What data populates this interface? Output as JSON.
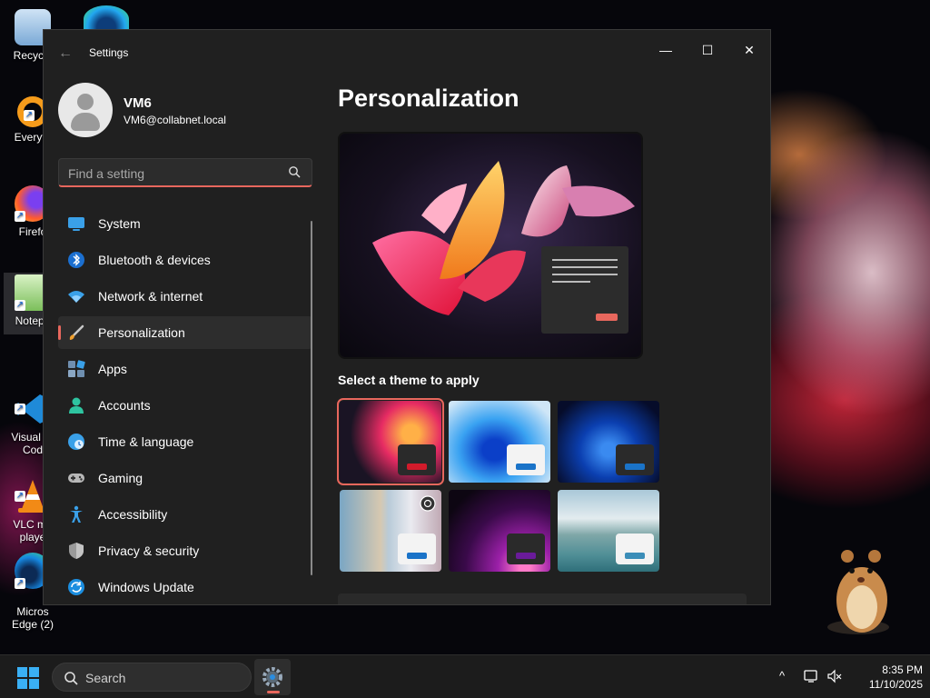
{
  "desktop": {
    "icons": [
      {
        "label": "Recycle"
      },
      {
        "label": "Everyth"
      },
      {
        "label": "Firefo"
      },
      {
        "label": "Notepa"
      },
      {
        "label": "Visual St\nCod"
      },
      {
        "label": "VLC me\nplaye"
      },
      {
        "label": "Micros\nEdge (2)"
      }
    ]
  },
  "window": {
    "app_title": "Settings",
    "controls": {
      "minimize": "—",
      "maximize": "☐",
      "close": "✕"
    }
  },
  "profile": {
    "name": "VM6",
    "email": "VM6@collabnet.local"
  },
  "search": {
    "placeholder": "Find a setting"
  },
  "nav": {
    "items": [
      {
        "label": "System",
        "icon": "monitor-icon"
      },
      {
        "label": "Bluetooth & devices",
        "icon": "bluetooth-icon"
      },
      {
        "label": "Network & internet",
        "icon": "wifi-icon"
      },
      {
        "label": "Personalization",
        "icon": "paintbrush-icon",
        "active": true
      },
      {
        "label": "Apps",
        "icon": "apps-icon"
      },
      {
        "label": "Accounts",
        "icon": "person-icon"
      },
      {
        "label": "Time & language",
        "icon": "globe-clock-icon"
      },
      {
        "label": "Gaming",
        "icon": "gamepad-icon"
      },
      {
        "label": "Accessibility",
        "icon": "accessibility-icon"
      },
      {
        "label": "Privacy & security",
        "icon": "shield-icon"
      },
      {
        "label": "Windows Update",
        "icon": "update-icon"
      }
    ]
  },
  "content": {
    "page_title": "Personalization",
    "theme_section_label": "Select a theme to apply",
    "themes": [
      {
        "name": "glow-dark",
        "selected": true,
        "chip_bar_color": "#d21b2b"
      },
      {
        "name": "bloom-light",
        "chip_bar_color": "#1a73c8"
      },
      {
        "name": "bloom-dark",
        "chip_bar_color": "#1a73c8"
      },
      {
        "name": "spotlight",
        "chip_bar_color": "#1a73c8"
      },
      {
        "name": "captured-motion",
        "chip_bar_color": "#6a1b9a"
      },
      {
        "name": "flow",
        "chip_bar_color": "#3b8db8"
      }
    ]
  },
  "taskbar": {
    "search_label": "Search",
    "time": "8:35 PM",
    "date": "11/10/2025",
    "tray_chevron": "^"
  },
  "colors": {
    "accent": "#e8675d",
    "window_bg": "#202020",
    "taskbar_bg": "#1c1c1c"
  }
}
